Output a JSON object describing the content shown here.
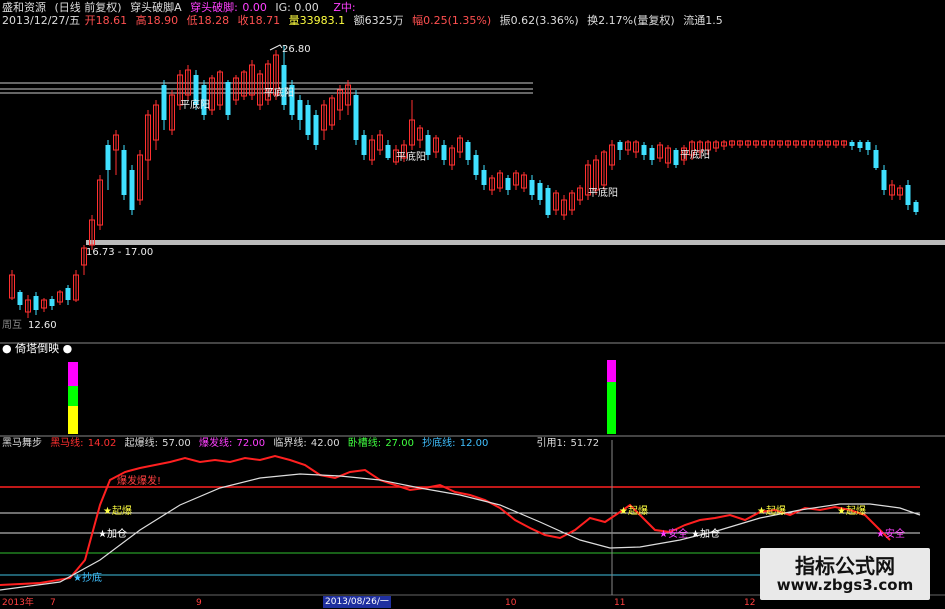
{
  "header": {
    "row1": {
      "stock": "盛和资源",
      "period": "(日线 前复权)",
      "indicator": "穿头破脚A",
      "indicator2_label": "穿头破脚:",
      "indicator2_val": "0.00",
      "ig": "IG: 0.00",
      "z": "Z中:"
    },
    "row2": {
      "date": "2013/12/27/五",
      "open": "开18.61",
      "high": "高18.90",
      "low": "低18.28",
      "close": "收18.71",
      "volume": "量33983.1",
      "amount": "额6325万",
      "change": "幅0.25(1.35%)",
      "amplitude": "振0.62(3.36%)",
      "turnover": "换2.17%(量复权)",
      "float": "流通1.5"
    }
  },
  "main_labels": {
    "high_mark": "26.80",
    "band_label": "16.73 - 17.00",
    "low_mark": "12.60",
    "low_prefix": "周互",
    "pingdiyang": "平底阳"
  },
  "panel2": {
    "title": "● 倚塔倒映 ●"
  },
  "panel3": {
    "title": "黑马舞步",
    "items": [
      {
        "label": "黑马线:",
        "value": "14.02"
      },
      {
        "label": "起爆线:",
        "value": "57.00"
      },
      {
        "label": "爆发线:",
        "value": "72.00"
      },
      {
        "label": "临界线:",
        "value": "42.00"
      },
      {
        "label": "卧槽线:",
        "value": "27.00"
      },
      {
        "label": "抄底线:",
        "value": "12.00"
      },
      {
        "label": "引用1:",
        "value": "51.72"
      }
    ],
    "labels": {
      "qibao": "★起爆",
      "jiacang": "★加仓",
      "chaodi": "★抄底",
      "anquan": "★安全",
      "baofa": "爆发爆发!"
    }
  },
  "xaxis": {
    "ticks": [
      "2013年",
      "7",
      "9",
      "2013/08/26/一",
      "10",
      "11",
      "12"
    ]
  },
  "watermark": {
    "line1": "指标公式网",
    "line2": "www.zbgs3.com"
  },
  "colors": {
    "up": "#ff3030",
    "down": "#40e0ff",
    "yellow": "#ffff00",
    "magenta": "#ff00ff",
    "green": "#00ff00",
    "red": "#ff2020",
    "white": "#ffffff"
  }
}
